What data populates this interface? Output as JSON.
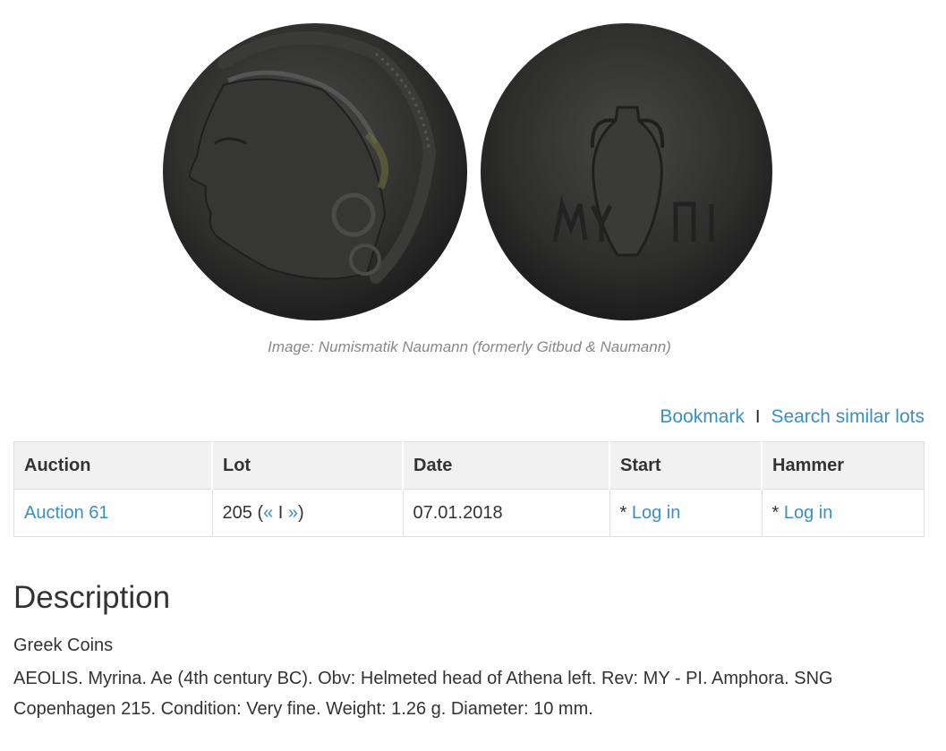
{
  "image": {
    "caption": "Image: Numismatik Naumann (formerly Gitbud & Naumann)",
    "obverse_alt": "coin-obverse-image",
    "reverse_alt": "coin-reverse-image"
  },
  "actions": {
    "bookmark": "Bookmark",
    "separator": "I",
    "search_similar": "Search similar lots"
  },
  "table": {
    "headers": [
      "Auction",
      "Lot",
      "Date",
      "Start",
      "Hammer"
    ],
    "row": {
      "auction": "Auction 61",
      "lot_number": "205",
      "lot_open": "(",
      "prev": "«",
      "lot_sep": "I",
      "next": "»",
      "lot_close": ")",
      "date": "07.01.2018",
      "start_prefix": "* ",
      "start_link": "Log in",
      "hammer_prefix": "* ",
      "hammer_link": "Log in"
    }
  },
  "description": {
    "title": "Description",
    "category": "Greek Coins",
    "text": "AEOLIS. Myrina. Ae (4th century BC). Obv: Helmeted head of Athena left. Rev: MY - PI. Amphora. SNG Copenhagen 215. Condition: Very fine. Weight: 1.26 g. Diameter: 10 mm."
  },
  "colors": {
    "link": "#3b8fc1",
    "header_bg": "#f1f1f1",
    "coin_dark": "#2b2b2b"
  }
}
